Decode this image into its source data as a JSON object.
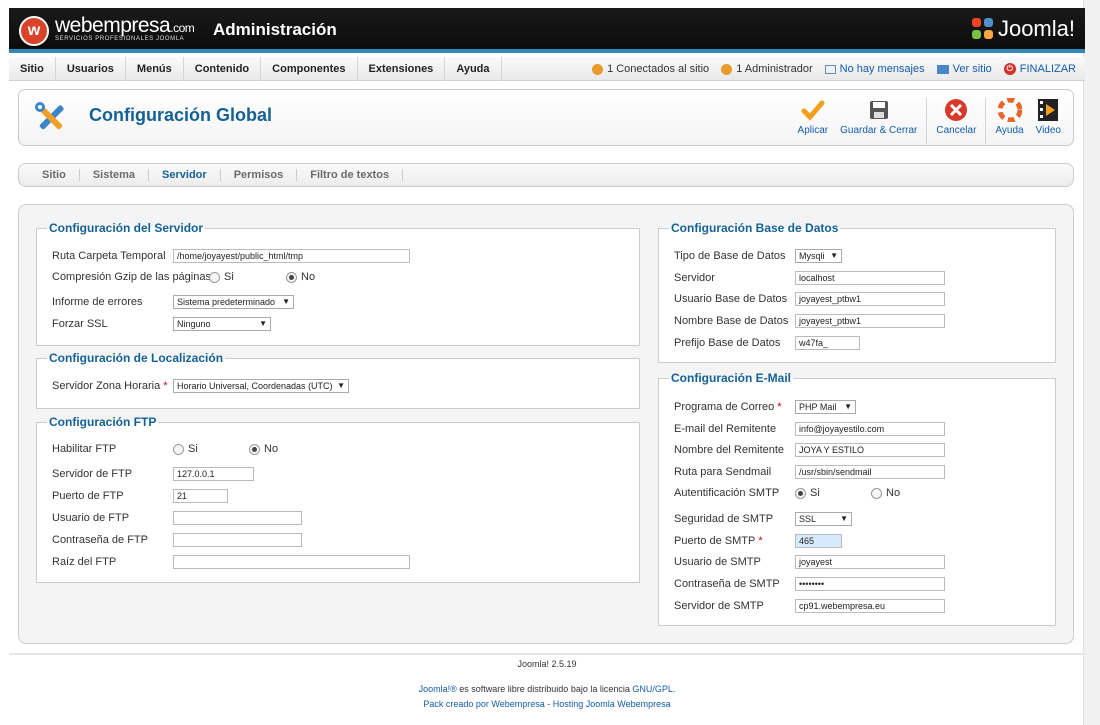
{
  "brand": {
    "logo_main": "webempresa",
    "logo_suffix": ".com",
    "logo_sub": "SERVICIOS PROFESIONALES JOOMLA",
    "admin_title": "Administración",
    "joomla_logo": "Joomla!"
  },
  "menubar": {
    "items": [
      "Sitio",
      "Usuarios",
      "Menús",
      "Contenido",
      "Componentes",
      "Extensiones",
      "Ayuda"
    ],
    "status": {
      "connected": "1 Conectados al sitio",
      "admin": "1 Administrador",
      "messages": "No hay mensajes",
      "view_site": "Ver sitio",
      "logout": "FINALIZAR"
    }
  },
  "toolbar": {
    "page_title": "Configuración Global",
    "buttons": {
      "apply": "Aplicar",
      "save_close": "Guardar & Cerrar",
      "cancel": "Cancelar",
      "help": "Ayuda",
      "video": "Video"
    }
  },
  "tabs": [
    "Sitio",
    "Sistema",
    "Servidor",
    "Permisos",
    "Filtro de textos"
  ],
  "server": {
    "legend": "Configuración del Servidor",
    "temp_path_label": "Ruta Carpeta Temporal",
    "temp_path_value": "/home/joyayest/public_html/tmp",
    "gzip_label": "Compresión Gzip de las páginas",
    "yes": "Si",
    "no": "No",
    "error_label": "Informe de errores",
    "error_value": "Sistema predeterminado",
    "ssl_label": "Forzar SSL",
    "ssl_value": "Ninguno"
  },
  "locale": {
    "legend": "Configuración de Localización",
    "tz_label": "Servidor Zona Horaria",
    "tz_value": "Horario Universal, Coordenadas (UTC)"
  },
  "ftp": {
    "legend": "Configuración FTP",
    "enable_label": "Habilitar FTP",
    "yes": "Si",
    "no": "No",
    "host_label": "Servidor de FTP",
    "host_value": "127.0.0.1",
    "port_label": "Puerto de FTP",
    "port_value": "21",
    "user_label": "Usuario de FTP",
    "user_value": "",
    "pass_label": "Contraseña de FTP",
    "pass_value": "",
    "root_label": "Raíz del FTP",
    "root_value": ""
  },
  "database": {
    "legend": "Configuración Base de Datos",
    "type_label": "Tipo de Base de Datos",
    "type_value": "Mysqli",
    "host_label": "Servidor",
    "host_value": "localhost",
    "user_label": "Usuario Base de Datos",
    "user_value": "joyayest_ptbw1",
    "name_label": "Nombre Base de Datos",
    "name_value": "joyayest_ptbw1",
    "prefix_label": "Prefijo Base de Datos",
    "prefix_value": "w47fa_"
  },
  "mail": {
    "legend": "Configuración E-Mail",
    "mailer_label": "Programa de Correo",
    "mailer_value": "PHP Mail",
    "from_email_label": "E-mail del Remitente",
    "from_email_value": "info@joyayestilo.com",
    "from_name_label": "Nombre del Remitente",
    "from_name_value": "JOYA Y ESTILO",
    "sendmail_label": "Ruta para Sendmail",
    "sendmail_value": "/usr/sbin/sendmail",
    "smtp_auth_label": "Autentificación SMTP",
    "yes": "Si",
    "no": "No",
    "smtp_secure_label": "Seguridad de SMTP",
    "smtp_secure_value": "SSL",
    "smtp_port_label": "Puerto de SMTP",
    "smtp_port_value": "465",
    "smtp_user_label": "Usuario de SMTP",
    "smtp_user_value": "joyayest",
    "smtp_pass_label": "Contraseña de SMTP",
    "smtp_pass_value": "••••••••",
    "smtp_host_label": "Servidor de SMTP",
    "smtp_host_value": "cp91.webempresa.eu"
  },
  "footer": {
    "version": "Joomla! 2.5.19",
    "license_link": "Joomla!®",
    "license_text": " es software libre distribuido bajo la licencia ",
    "gpl_link": "GNU/GPL.",
    "pack_link": "Pack creado por Webempresa",
    "sep": " - ",
    "hosting_link": "Hosting Joomla Webempresa"
  }
}
